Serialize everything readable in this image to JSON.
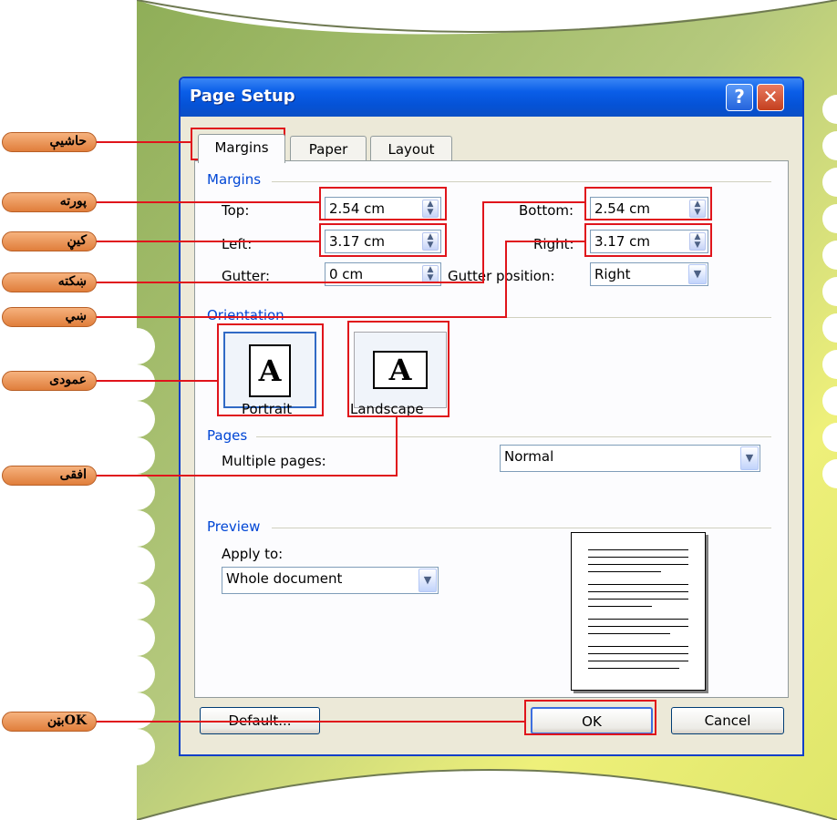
{
  "dialog": {
    "title": "Page Setup",
    "help_label": "?",
    "close_label": "✕",
    "tabs": [
      {
        "label": "Margins",
        "active": true
      },
      {
        "label": "Paper",
        "active": false
      },
      {
        "label": "Layout",
        "active": false
      }
    ]
  },
  "margins": {
    "group_label": "Margins",
    "top": {
      "label": "Top:",
      "value": "2.54 cm"
    },
    "bottom": {
      "label": "Bottom:",
      "value": "2.54 cm"
    },
    "left": {
      "label": "Left:",
      "value": "3.17 cm"
    },
    "right": {
      "label": "Right:",
      "value": "3.17 cm"
    },
    "gutter": {
      "label": "Gutter:",
      "value": "0 cm"
    },
    "gutter_position": {
      "label": "Gutter position:",
      "value": "Right"
    }
  },
  "orientation": {
    "group_label": "Orientation",
    "portrait_label": "Portrait",
    "landscape_label": "Landscape",
    "glyph": "A"
  },
  "pages": {
    "group_label": "Pages",
    "multiple_label": "Multiple pages:",
    "multiple_value": "Normal"
  },
  "preview": {
    "group_label": "Preview",
    "apply_label": "Apply to:",
    "apply_value": "Whole document"
  },
  "buttons": {
    "default_label": "Default...",
    "ok_label": "OK",
    "cancel_label": "Cancel"
  },
  "callouts": {
    "margins_tab": "حاشيې",
    "top": "پورته",
    "left": "کيڼ",
    "gutter_bottom": "ښکته",
    "right": "ښي",
    "portrait": "عمودی",
    "landscape": "افقی",
    "ok": "OKبټن"
  },
  "colors": {
    "title_bar": "#0a5ee8",
    "group_label": "#0046d5",
    "highlight": "#e0141b",
    "callout": "#e07e3b",
    "background_green": "#a9bf6e"
  }
}
